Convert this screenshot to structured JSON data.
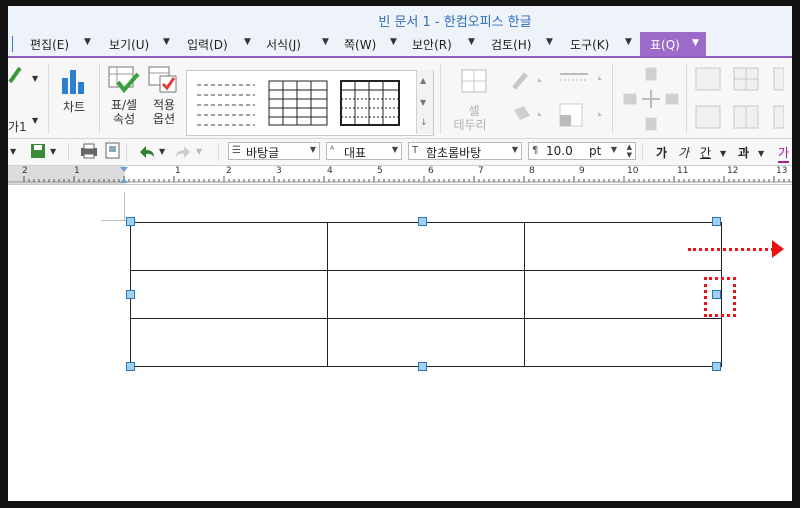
{
  "window": {
    "title": "빈 문서 1 - 한컴오피스 한글"
  },
  "menu": {
    "items": [
      {
        "label": "편집(E)"
      },
      {
        "label": "보기(U)"
      },
      {
        "label": "입력(D)"
      },
      {
        "label": "서식(J)"
      },
      {
        "label": "쪽(W)"
      },
      {
        "label": "보안(R)"
      },
      {
        "label": "검토(H)"
      },
      {
        "label": "도구(K)"
      }
    ],
    "active": "표(Q)"
  },
  "ribbon": {
    "left_fragment": "가1",
    "chart": "차트",
    "table_cell_props": [
      "표/셀",
      "속성"
    ],
    "apply_options": [
      "적용",
      "옵션"
    ],
    "cell_border": [
      "셀",
      "테두리"
    ]
  },
  "toolbar": {
    "style_name": "바탕글",
    "language": "대표",
    "font": "함초롬바탕",
    "font_size": "10.0",
    "size_unit": "pt",
    "format_glyphs": [
      "가",
      "가",
      "간",
      "과",
      "가"
    ]
  },
  "ruler": {
    "ticks": [
      "2",
      "1",
      "1",
      "2",
      "3",
      "4",
      "5",
      "6",
      "7",
      "8",
      "9",
      "10",
      "11",
      "12",
      "13"
    ]
  },
  "colors": {
    "accent": "#9c6bc9",
    "title": "#2e6fb8",
    "annotation": "#ee1111",
    "handle": "#9fd2f2"
  }
}
